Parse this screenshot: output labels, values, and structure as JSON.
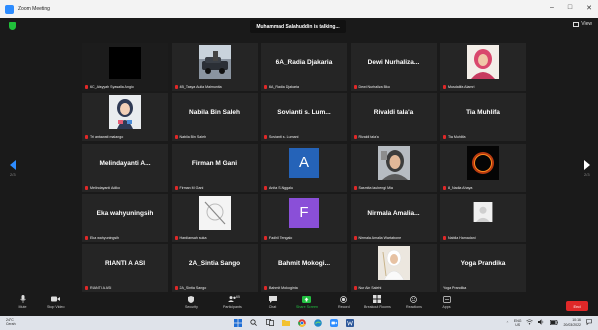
{
  "window": {
    "title": "Zoom Meeting",
    "minimize": "–",
    "maximize": "□",
    "close": "✕"
  },
  "top": {
    "talking": "Muhammad Salahuddin is talking...",
    "view": "View"
  },
  "nav": {
    "left_page": "2/3",
    "right_page": "2/3"
  },
  "tiles": [
    {
      "name": "",
      "label": "6C_Aisyyah Syasalla Angio",
      "type": "dark"
    },
    {
      "name": "",
      "label": "4B_Tasya Aulia Maimunita",
      "type": "photo-car"
    },
    {
      "name": "6A_Radia Djakaria",
      "label": "6A_Radia Djakaria",
      "type": "text"
    },
    {
      "name": "Dewi Nurhaliza...",
      "label": "Dewi Nurhaliza Bko",
      "type": "text"
    },
    {
      "name": "",
      "label": "Musdalifa Alamri",
      "type": "photo-hijab-pink"
    },
    {
      "name": "",
      "label": "Tri antawati malango",
      "type": "photo-cartoon"
    },
    {
      "name": "Nabila Bin Saleh",
      "label": "Nabila Bin Saleh",
      "type": "text"
    },
    {
      "name": "Sovianti s. Lum...",
      "label": "Sovianti s. Lumani",
      "type": "text"
    },
    {
      "name": "Rivaldi tala'a",
      "label": "Rivaldi tala'a",
      "type": "text"
    },
    {
      "name": "Tia Muhlifa",
      "label": "Tia Muhlifa",
      "type": "text"
    },
    {
      "name": "Melindayanti A...",
      "label": "Melindayanti Adiko",
      "type": "text"
    },
    {
      "name": "Firman M Gani",
      "label": "Firman M Gani",
      "type": "text"
    },
    {
      "name": "",
      "label": "Anita S.Nggalu",
      "type": "letter",
      "letter": "A",
      "color": "#2563b8"
    },
    {
      "name": "",
      "label": "Sasmita laubengi Mia",
      "type": "photo-selfie"
    },
    {
      "name": "",
      "label": "8_Nadia Ahaya",
      "type": "photo-eclipse"
    },
    {
      "name": "Eka wahyuningsih",
      "label": "Eka wahyuningsih",
      "type": "text"
    },
    {
      "name": "",
      "label": "Hardiansah suka",
      "type": "photo-blank"
    },
    {
      "name": "",
      "label": "Fadhil Tengalo",
      "type": "letter",
      "letter": "F",
      "color": "#8a4fd8"
    },
    {
      "name": "Nirmala Amalia...",
      "label": "Nirmala Amalia Wartabone",
      "type": "text"
    },
    {
      "name": "",
      "label": "Nabila Hamadani",
      "type": "photo-small"
    },
    {
      "name": "RIANTI A ASI",
      "label": "RIANTI A ASI",
      "type": "text"
    },
    {
      "name": "2A_Sintia Sango",
      "label": "2A_Sintia Sango",
      "type": "text"
    },
    {
      "name": "Bahmit Mokogi...",
      "label": "Bahmit Mokoginta",
      "type": "text"
    },
    {
      "name": "",
      "label": "Nur Ain Salehi",
      "type": "photo-bride"
    },
    {
      "name": "Yoga Prandika",
      "label": "Yoga Prandika",
      "type": "text",
      "unmuted": true
    }
  ],
  "toolbar": {
    "mute": "Mute",
    "stop_video": "Stop Video",
    "security": "Security",
    "participants": "Participants",
    "participants_count": "65",
    "chat": "Chat",
    "share_screen": "Share Screen",
    "record": "Record",
    "breakout": "Breakout Rooms",
    "reactions": "Reactions",
    "apps": "Apps",
    "end": "End"
  },
  "taskbar": {
    "temp": "24°C",
    "weather": "Cerah",
    "lang": "ENG",
    "region": "US",
    "time": "10:16",
    "date": "20/03/2022"
  }
}
